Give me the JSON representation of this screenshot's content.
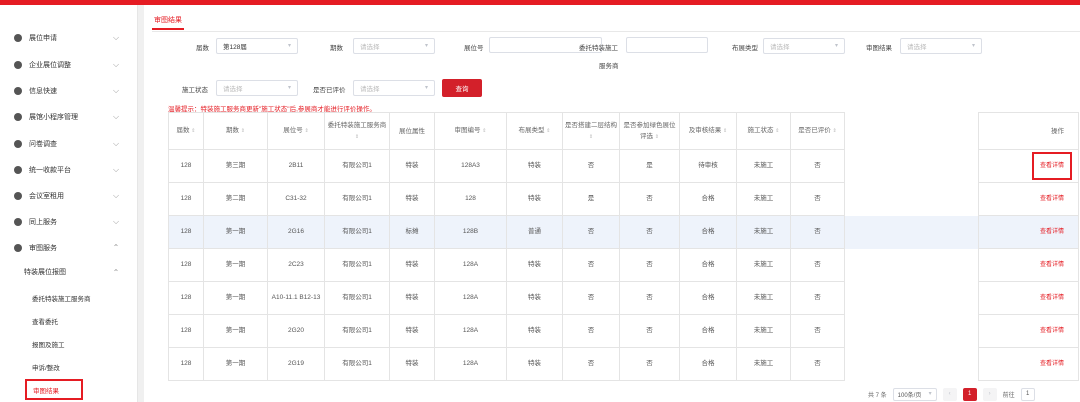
{
  "sidebar": {
    "items": [
      {
        "label": "展位申请"
      },
      {
        "label": "企业展位调整"
      },
      {
        "label": "信息快速"
      },
      {
        "label": "展馆小程序管理"
      },
      {
        "label": "问卷调查"
      },
      {
        "label": "统一收款平台"
      },
      {
        "label": "会议室租用"
      },
      {
        "label": "同上服务"
      },
      {
        "label": "审图服务"
      }
    ],
    "group": {
      "label": "特装展位报图"
    },
    "leaves": [
      {
        "label": "委托特装施工服务商"
      },
      {
        "label": "查看委托"
      },
      {
        "label": "报图及施工"
      },
      {
        "label": "申诉/整改"
      },
      {
        "label": "审图结果"
      }
    ]
  },
  "tab": {
    "label": "审图结果"
  },
  "filters": {
    "session_label": "届数",
    "session_value": "第128届",
    "phase_label": "期数",
    "phase_placeholder": "请选择",
    "booth_label": "展位号",
    "contractor_label_1": "委托特装施工",
    "contractor_label_2": "服务商",
    "layout_label": "布展类型",
    "layout_placeholder": "请选择",
    "review_label": "审图结果",
    "review_placeholder": "请选择",
    "construction_label": "施工状态",
    "construction_placeholder": "请选择",
    "rated_label": "是否已评价",
    "rated_placeholder": "请选择",
    "query_button": "查询"
  },
  "notice": "温馨提示：特装施工服务商更新\"施工状态\"后,参展商才能进行评价操作。",
  "table": {
    "headers": [
      "届数",
      "期数",
      "展位号",
      "委托特装施工服务商",
      "展位属性",
      "审图编号",
      "布展类型",
      "是否搭建二层结构",
      "是否参加绿色展位评选",
      "及审核结果",
      "施工状态",
      "是否已评价",
      "",
      "操作"
    ],
    "rows": [
      {
        "session": "128",
        "phase": "第三期",
        "booth": "2B11",
        "contractor": "有限公司1",
        "attr": "特装",
        "code": "128A3",
        "layout": "特装",
        "two_floor": "否",
        "green": "是",
        "result": "待审核",
        "status": "未施工",
        "rated": "否",
        "op": "查看详情"
      },
      {
        "session": "128",
        "phase": "第二期",
        "booth": "C31-32",
        "contractor": "有限公司1",
        "attr": "特装",
        "code": "128",
        "layout": "特装",
        "two_floor": "是",
        "green": "否",
        "result": "合格",
        "status": "未施工",
        "rated": "否",
        "op": "查看详情"
      },
      {
        "session": "128",
        "phase": "第一期",
        "booth": "2G16",
        "contractor": "有限公司1",
        "attr": "标摊",
        "code": "128B",
        "layout": "普通",
        "two_floor": "否",
        "green": "否",
        "result": "合格",
        "status": "未施工",
        "rated": "否",
        "op": "查看详情"
      },
      {
        "session": "128",
        "phase": "第一期",
        "booth": "2C23",
        "contractor": "有限公司1",
        "attr": "特装",
        "code": "128A",
        "layout": "特装",
        "two_floor": "否",
        "green": "否",
        "result": "合格",
        "status": "未施工",
        "rated": "否",
        "op": "查看详情"
      },
      {
        "session": "128",
        "phase": "第一期",
        "booth": "A10-11.1 B12-13",
        "contractor": "有限公司1",
        "attr": "特装",
        "code": "128A",
        "layout": "特装",
        "two_floor": "否",
        "green": "否",
        "result": "合格",
        "status": "未施工",
        "rated": "否",
        "op": "查看详情"
      },
      {
        "session": "128",
        "phase": "第一期",
        "booth": "2G20",
        "contractor": "有限公司1",
        "attr": "特装",
        "code": "128A",
        "layout": "特装",
        "two_floor": "否",
        "green": "否",
        "result": "合格",
        "status": "未施工",
        "rated": "否",
        "op": "查看详情"
      },
      {
        "session": "128",
        "phase": "第一期",
        "booth": "2G19",
        "contractor": "有限公司1",
        "attr": "特装",
        "code": "128A",
        "layout": "特装",
        "two_floor": "否",
        "green": "否",
        "result": "合格",
        "status": "未施工",
        "rated": "否",
        "op": "查看详情"
      }
    ]
  },
  "pager": {
    "total": "共 7 条",
    "size": "100条/页",
    "page": "1",
    "goto_label": "前往",
    "goto_value": "1"
  }
}
